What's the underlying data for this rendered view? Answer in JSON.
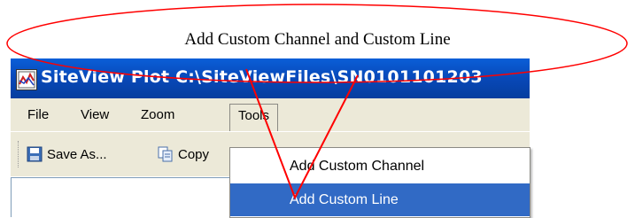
{
  "annotation": {
    "text": "Add Custom Channel and Custom Line",
    "color": "#ff0000"
  },
  "window": {
    "title": "SiteView Plot C:\\SiteViewFiles\\SN0101101203",
    "title_bar_color": "#0a5fd8",
    "app_icon": "siteview-app-icon"
  },
  "menu": {
    "items": [
      {
        "label": "File"
      },
      {
        "label": "View"
      },
      {
        "label": "Zoom"
      },
      {
        "label": "Tools"
      }
    ],
    "open_menu": "Tools"
  },
  "toolbar": {
    "save_as_label": "Save As...",
    "save_as_icon": "save-as-icon",
    "copy_label": "Copy",
    "copy_icon": "copy-icon"
  },
  "tools_menu": {
    "items": [
      {
        "label": "Add Custom Channel",
        "highlighted": false
      },
      {
        "label": "Add Custom Line",
        "highlighted": true
      }
    ],
    "highlight_color": "#316ac5"
  }
}
